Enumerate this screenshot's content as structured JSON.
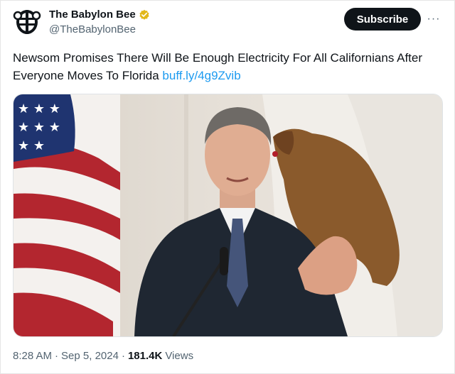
{
  "account": {
    "display_name": "The Babylon Bee",
    "handle": "@TheBabylonBee",
    "verified_icon": "gold-verified-badge-icon",
    "avatar_icon": "bee-logo-icon"
  },
  "actions": {
    "subscribe_label": "Subscribe",
    "more_label": "···"
  },
  "tweet": {
    "text": "Newsom Promises There Will Be Enough Electricity For All Californians After Everyone Moves To Florida ",
    "link": "buff.ly/4g9Zvib"
  },
  "media": {
    "description_icon": "photo-man-at-podium-with-flags"
  },
  "meta": {
    "time": "8:28 AM",
    "separator": "·",
    "date": "Sep 5, 2024",
    "views_count": "181.4K",
    "views_label": "Views"
  },
  "colors": {
    "accent": "#1d9bf0",
    "text": "#0f1419",
    "muted": "#536471",
    "badge": "#e2b719"
  }
}
